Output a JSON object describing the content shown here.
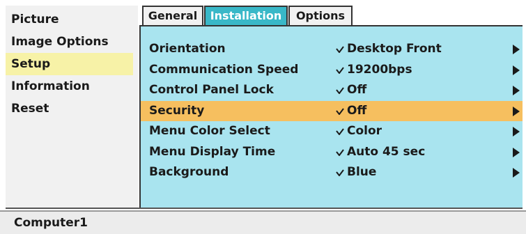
{
  "left_menu": {
    "items": [
      {
        "label": "Picture"
      },
      {
        "label": "Image Options"
      },
      {
        "label": "Setup"
      },
      {
        "label": "Information"
      },
      {
        "label": "Reset"
      }
    ],
    "selected": "Setup"
  },
  "tabs": [
    {
      "label": "General"
    },
    {
      "label": "Installation"
    },
    {
      "label": "Options"
    }
  ],
  "active_tab": "Installation",
  "settings": [
    {
      "label": "Orientation",
      "value": "Desktop Front"
    },
    {
      "label": "Communication Speed",
      "value": "19200bps"
    },
    {
      "label": "Control Panel Lock",
      "value": "Off"
    },
    {
      "label": "Security",
      "value": "Off"
    },
    {
      "label": "Menu Color Select",
      "value": "Color"
    },
    {
      "label": "Menu Display Time",
      "value": "Auto 45 sec"
    },
    {
      "label": "Background",
      "value": "Blue"
    }
  ],
  "highlighted_setting": "Security",
  "status": {
    "source": "Computer1"
  },
  "colors": {
    "active_tab": "#39b8c8",
    "content_bg": "#a9e4ef",
    "highlight_row": "#f6bf5f",
    "selected_menu": "#f7f2a7"
  }
}
